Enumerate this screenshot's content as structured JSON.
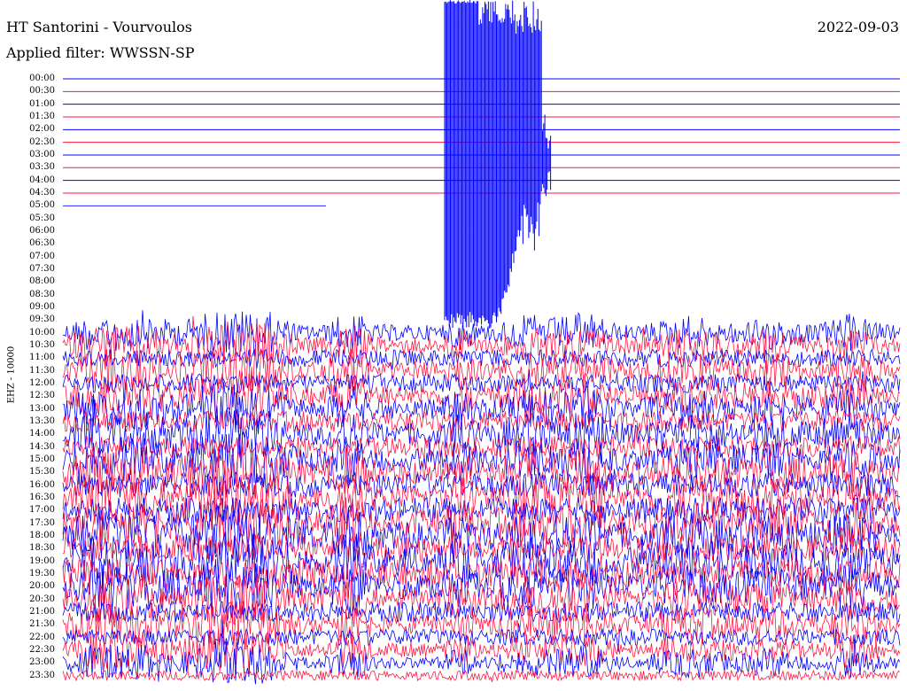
{
  "header": {
    "station": "HT Santorini - Vourvoulos",
    "filter": "Applied filter: WWSSN-SP",
    "date": "2022-09-03"
  },
  "chart_data": {
    "type": "line",
    "title": "HT Santorini - Vourvoulos",
    "channel_label": "EHZ - 10000",
    "rows": [
      "00:00",
      "00:30",
      "01:00",
      "01:30",
      "02:00",
      "02:30",
      "03:00",
      "03:30",
      "04:00",
      "04:30",
      "05:00",
      "05:30",
      "06:00",
      "06:30",
      "07:00",
      "07:30",
      "08:00",
      "08:30",
      "09:00",
      "09:30",
      "10:00",
      "10:30",
      "11:00",
      "11:30",
      "12:00",
      "12:30",
      "13:00",
      "13:30",
      "14:00",
      "14:30",
      "15:00",
      "15:30",
      "16:00",
      "16:30",
      "17:00",
      "17:30",
      "18:00",
      "18:30",
      "19:00",
      "19:30",
      "20:00",
      "20:30",
      "21:00",
      "21:30",
      "22:00",
      "22:30",
      "23:00",
      "23:30"
    ],
    "row_minutes": 30,
    "recorded_until": "05:00 row, 31% of row",
    "series_colors": [
      "#0000ff",
      "#ff1744"
    ],
    "grid": false,
    "legend": "none"
  }
}
